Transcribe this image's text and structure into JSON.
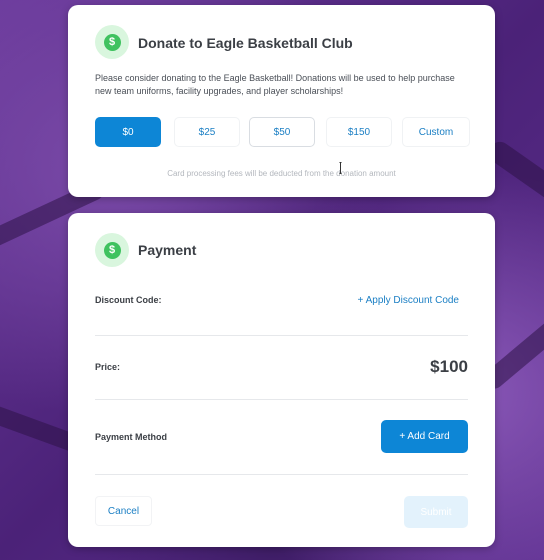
{
  "donate": {
    "title": "Donate to Eagle Basketball Club",
    "description": "Please consider donating to the Eagle Basketball! Donations will be used to help purchase new team uniforms, facility upgrades, and player scholarships!",
    "amounts": [
      {
        "label": "$0",
        "selected": true
      },
      {
        "label": "$25",
        "selected": false
      },
      {
        "label": "$50",
        "selected": false
      },
      {
        "label": "$150",
        "selected": false
      },
      {
        "label": "Custom",
        "selected": false
      }
    ],
    "fee_note": "Card processing fees will be deducted from the donation amount"
  },
  "payment": {
    "title": "Payment",
    "discount_label": "Discount Code:",
    "apply_discount": "+ Apply Discount Code",
    "price_label": "Price:",
    "price_value": "$100",
    "method_label": "Payment Method",
    "add_card": "+ Add Card",
    "cancel": "Cancel",
    "submit": "Submit"
  },
  "icons": {
    "dollar": "$"
  },
  "colors": {
    "accent": "#0d86d6",
    "badge_bg": "#d9f6de",
    "badge_coin": "#3fc25f"
  }
}
